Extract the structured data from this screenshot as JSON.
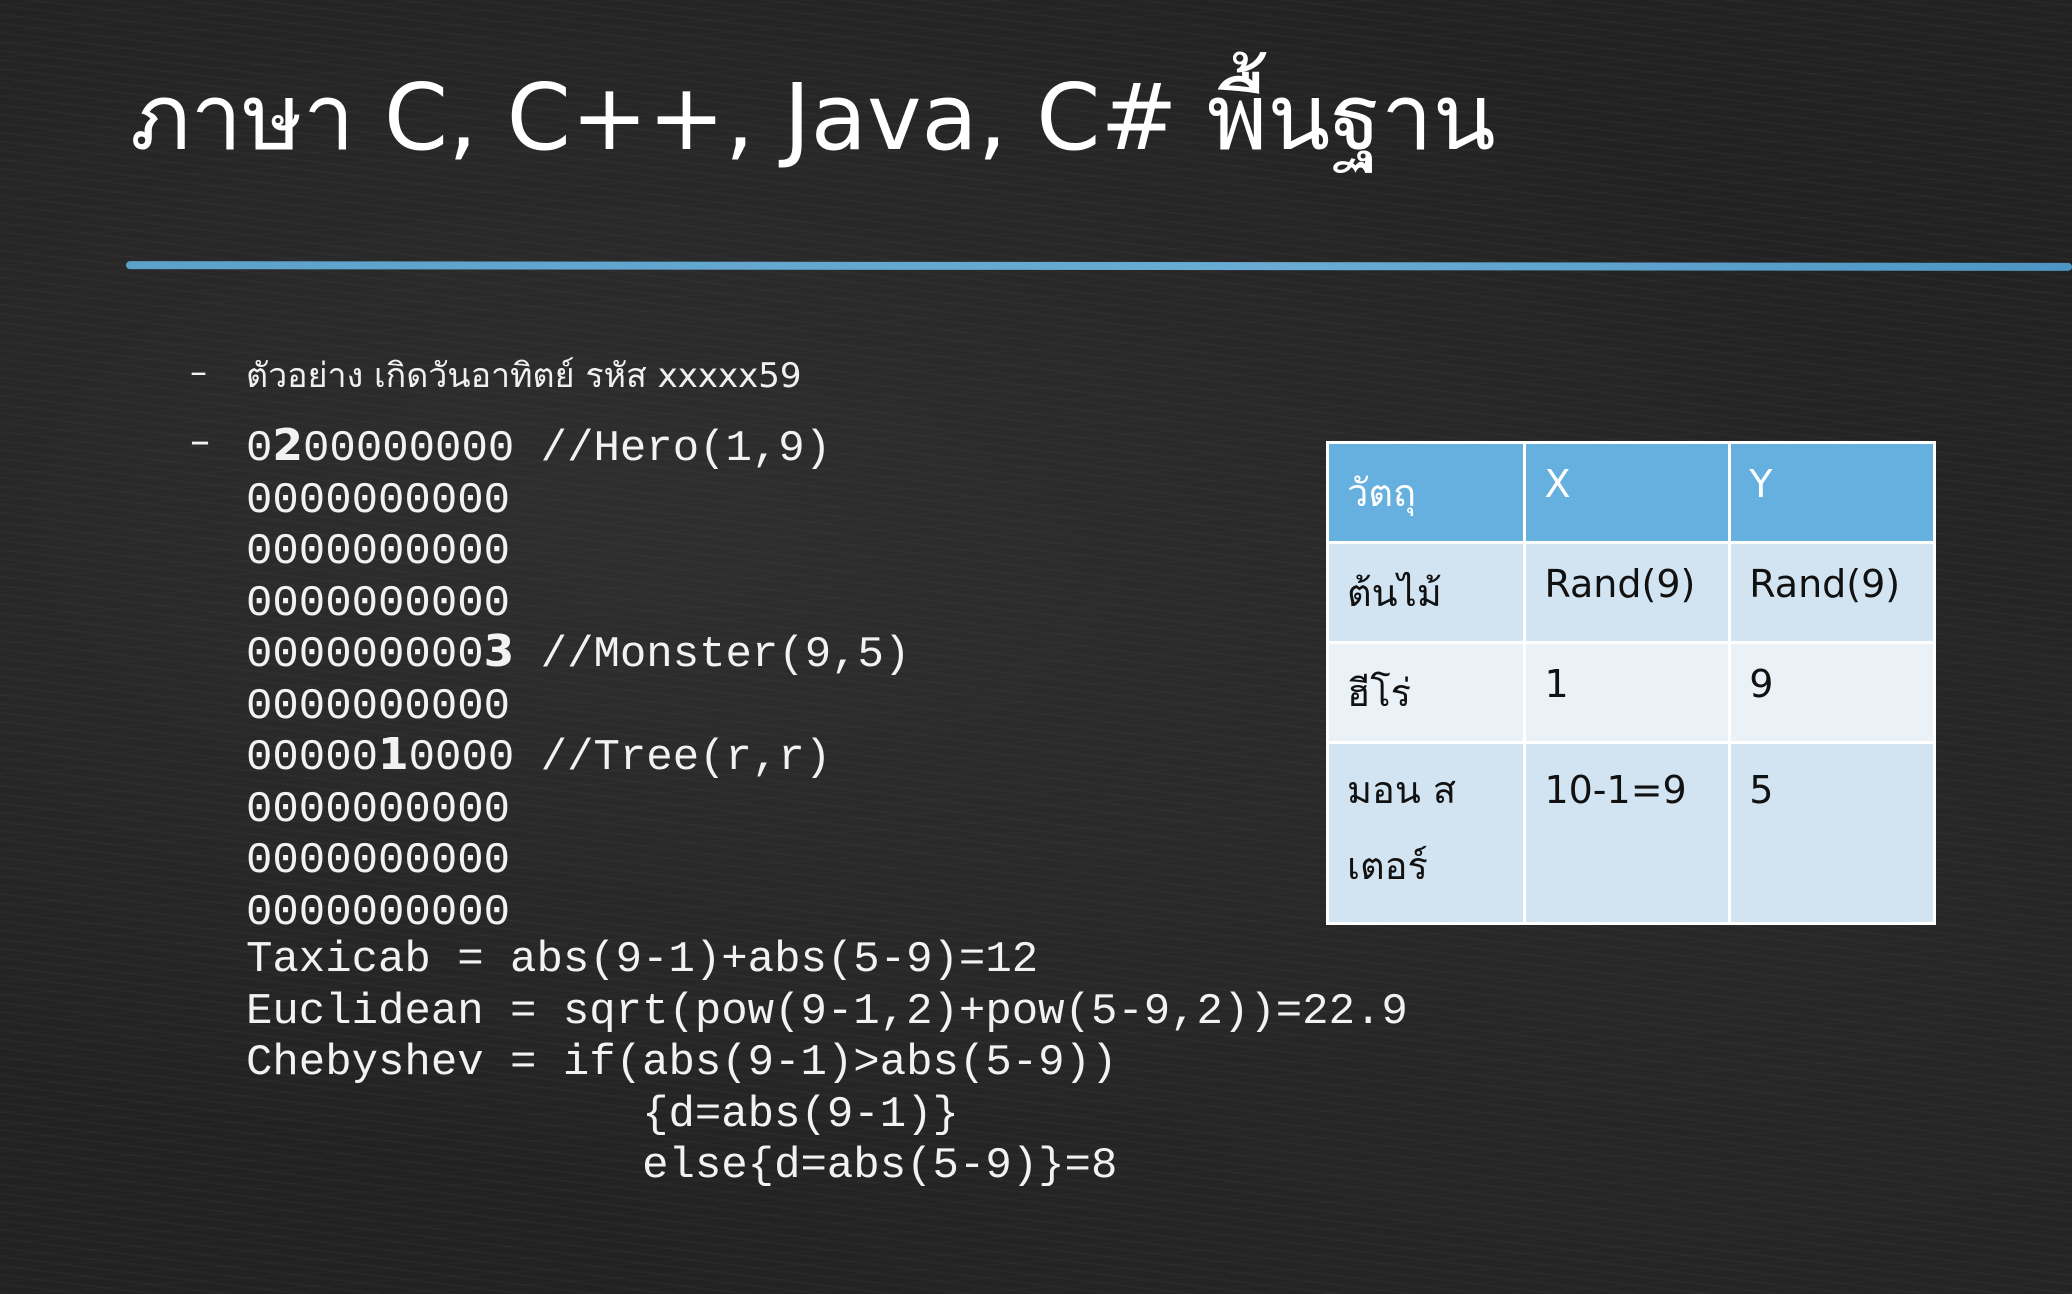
{
  "title": "ภาษา C, C++, Java, C# พื้นฐาน",
  "bullets": {
    "dash": "–",
    "example": "ตัวอย่าง เกิดวันอาทิตย์ รหัส xxxxx59"
  },
  "grid": {
    "rows": [
      {
        "pre": "0",
        "bold": "2",
        "post": "00000000",
        "comment": " //Hero(1,9)"
      },
      {
        "pre": "0000000000",
        "bold": "",
        "post": "",
        "comment": ""
      },
      {
        "pre": "0000000000",
        "bold": "",
        "post": "",
        "comment": ""
      },
      {
        "pre": "0000000000",
        "bold": "",
        "post": "",
        "comment": ""
      },
      {
        "pre": "000000000",
        "bold": "3",
        "post": "",
        "comment": " //Monster(9,5)"
      },
      {
        "pre": "0000000000",
        "bold": "",
        "post": "",
        "comment": ""
      },
      {
        "pre": "00000",
        "bold": "1",
        "post": "0000",
        "comment": " //Tree(r,r)"
      },
      {
        "pre": "0000000000",
        "bold": "",
        "post": "",
        "comment": ""
      },
      {
        "pre": "0000000000",
        "bold": "",
        "post": "",
        "comment": ""
      },
      {
        "pre": "0000000000",
        "bold": "",
        "post": "",
        "comment": ""
      }
    ]
  },
  "formulas": [
    "Taxicab = abs(9-1)+abs(5-9)=12",
    "Euclidean = sqrt(pow(9-1,2)+pow(5-9,2))=22.9",
    "Chebyshev = if(abs(9-1)>abs(5-9))",
    "               {d=abs(9-1)}",
    "               else{d=abs(5-9)}=8"
  ],
  "table": {
    "headers": [
      "วัตถุ",
      "X",
      "Y"
    ],
    "rows": [
      [
        "ต้นไม้",
        "Rand(9)",
        "Rand(9)"
      ],
      [
        "ฮีโร่",
        "1",
        "9"
      ],
      [
        "มอน สเตอร์",
        "10-1=9",
        "5"
      ]
    ]
  },
  "colors": {
    "accent_rule": "#5fa8d3",
    "table_header": "#66b0df",
    "table_row_dark": "#d2e4f1",
    "table_row_light": "#eaf2f8",
    "background": "#222222"
  }
}
